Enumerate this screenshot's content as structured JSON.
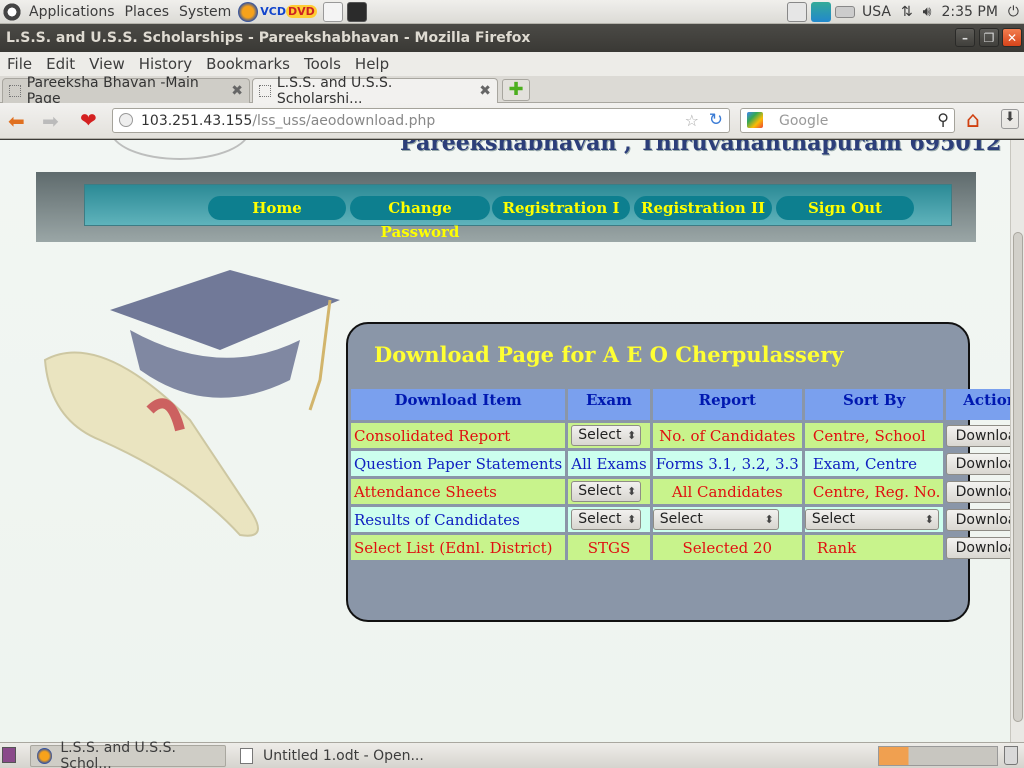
{
  "panel": {
    "menus": [
      "Applications",
      "Places",
      "System"
    ],
    "keyboard": "USA",
    "clock": "2:35 PM",
    "vcd": "VCD",
    "dvd": "DVD"
  },
  "window": {
    "title": "L.S.S. and U.S.S. Scholarships - Pareekshabhavan - Mozilla Firefox"
  },
  "menubar": [
    "File",
    "Edit",
    "View",
    "History",
    "Bookmarks",
    "Tools",
    "Help"
  ],
  "tabs": [
    {
      "label": "Pareeksha Bhavan -Main Page"
    },
    {
      "label": "L.S.S. and U.S.S. Scholarshi..."
    }
  ],
  "navbar": {
    "url_host": "103.251.43.155",
    "url_path": "/lss_uss/aeodownload.php",
    "search_placeholder": "Google"
  },
  "site": {
    "banner": "Pareekshabhavan , Thiruvananthapuram 695012",
    "nav": [
      "Home",
      "Change Password",
      "Registration I",
      "Registration II",
      "Sign Out"
    ]
  },
  "download": {
    "title": "Download Page for A E O Cherpulassery",
    "headers": [
      "Download Item",
      "Exam",
      "Report",
      "Sort By",
      "Action"
    ],
    "rows": [
      {
        "item": "Consolidated Report",
        "exam": "Select",
        "report": "No. of Candidates",
        "sort": "Centre, School",
        "action": "Download"
      },
      {
        "item": "Question Paper Statements",
        "exam": "All Exams",
        "report": "Forms 3.1, 3.2, 3.3",
        "sort": "Exam, Centre",
        "action": "Download"
      },
      {
        "item": "Attendance Sheets",
        "exam": "Select",
        "report": "All Candidates",
        "sort": "Centre, Reg. No.",
        "action": "Download"
      },
      {
        "item": "Results of Candidates",
        "exam": "Select",
        "report": "Select",
        "sort": "Select",
        "action": "Download"
      },
      {
        "item": "Select List (Ednl. District)",
        "exam": "STGS",
        "report": "Selected 20",
        "sort": "Rank",
        "action": "Download"
      }
    ]
  },
  "taskbar": [
    {
      "label": "L.S.S. and U.S.S. Schol..."
    },
    {
      "label": "Untitled 1.odt - Open..."
    }
  ]
}
